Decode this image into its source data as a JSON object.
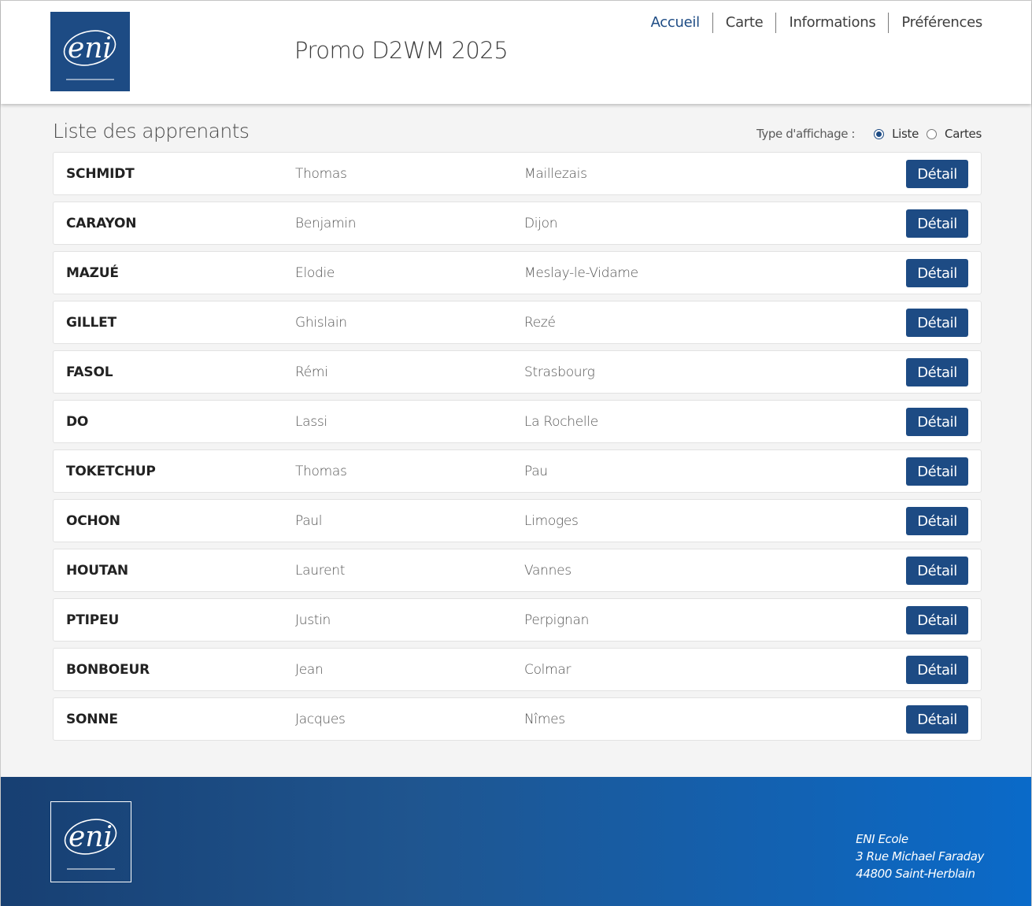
{
  "header": {
    "logo_text": "eni",
    "site_title": "Promo D2WM 2025",
    "nav": [
      {
        "label": "Accueil",
        "active": true
      },
      {
        "label": "Carte",
        "active": false
      },
      {
        "label": "Informations",
        "active": false
      },
      {
        "label": "Préférences",
        "active": false
      }
    ]
  },
  "list": {
    "title": "Liste des apprenants",
    "display_type_label": "Type d'affichage :",
    "options": [
      {
        "label": "Liste",
        "checked": true
      },
      {
        "label": "Cartes",
        "checked": false
      }
    ],
    "detail_label": "Détail",
    "rows": [
      {
        "last": "SCHMIDT",
        "first": "Thomas",
        "city": "Maillezais"
      },
      {
        "last": "CARAYON",
        "first": "Benjamin",
        "city": "Dijon"
      },
      {
        "last": "MAZUÉ",
        "first": "Elodie",
        "city": "Meslay-le-Vidame"
      },
      {
        "last": "GILLET",
        "first": "Ghislain",
        "city": "Rezé"
      },
      {
        "last": "FASOL",
        "first": "Rémi",
        "city": "Strasbourg"
      },
      {
        "last": "DO",
        "first": "Lassi",
        "city": "La Rochelle"
      },
      {
        "last": "TOKETCHUP",
        "first": "Thomas",
        "city": "Pau"
      },
      {
        "last": "OCHON",
        "first": "Paul",
        "city": "Limoges"
      },
      {
        "last": "HOUTAN",
        "first": "Laurent",
        "city": "Vannes"
      },
      {
        "last": "PTIPEU",
        "first": "Justin",
        "city": "Perpignan"
      },
      {
        "last": "BONBOEUR",
        "first": "Jean",
        "city": "Colmar"
      },
      {
        "last": "SONNE",
        "first": "Jacques",
        "city": "Nîmes"
      }
    ]
  },
  "footer": {
    "logo_text": "eni",
    "address": [
      "ENI Ecole",
      "3 Rue Michael Faraday",
      "44800 Saint-Herblain"
    ]
  },
  "colors": {
    "brand_blue": "#1d4b84",
    "footer_gradient_start": "#173f72",
    "footer_gradient_end": "#0a6ac9"
  }
}
